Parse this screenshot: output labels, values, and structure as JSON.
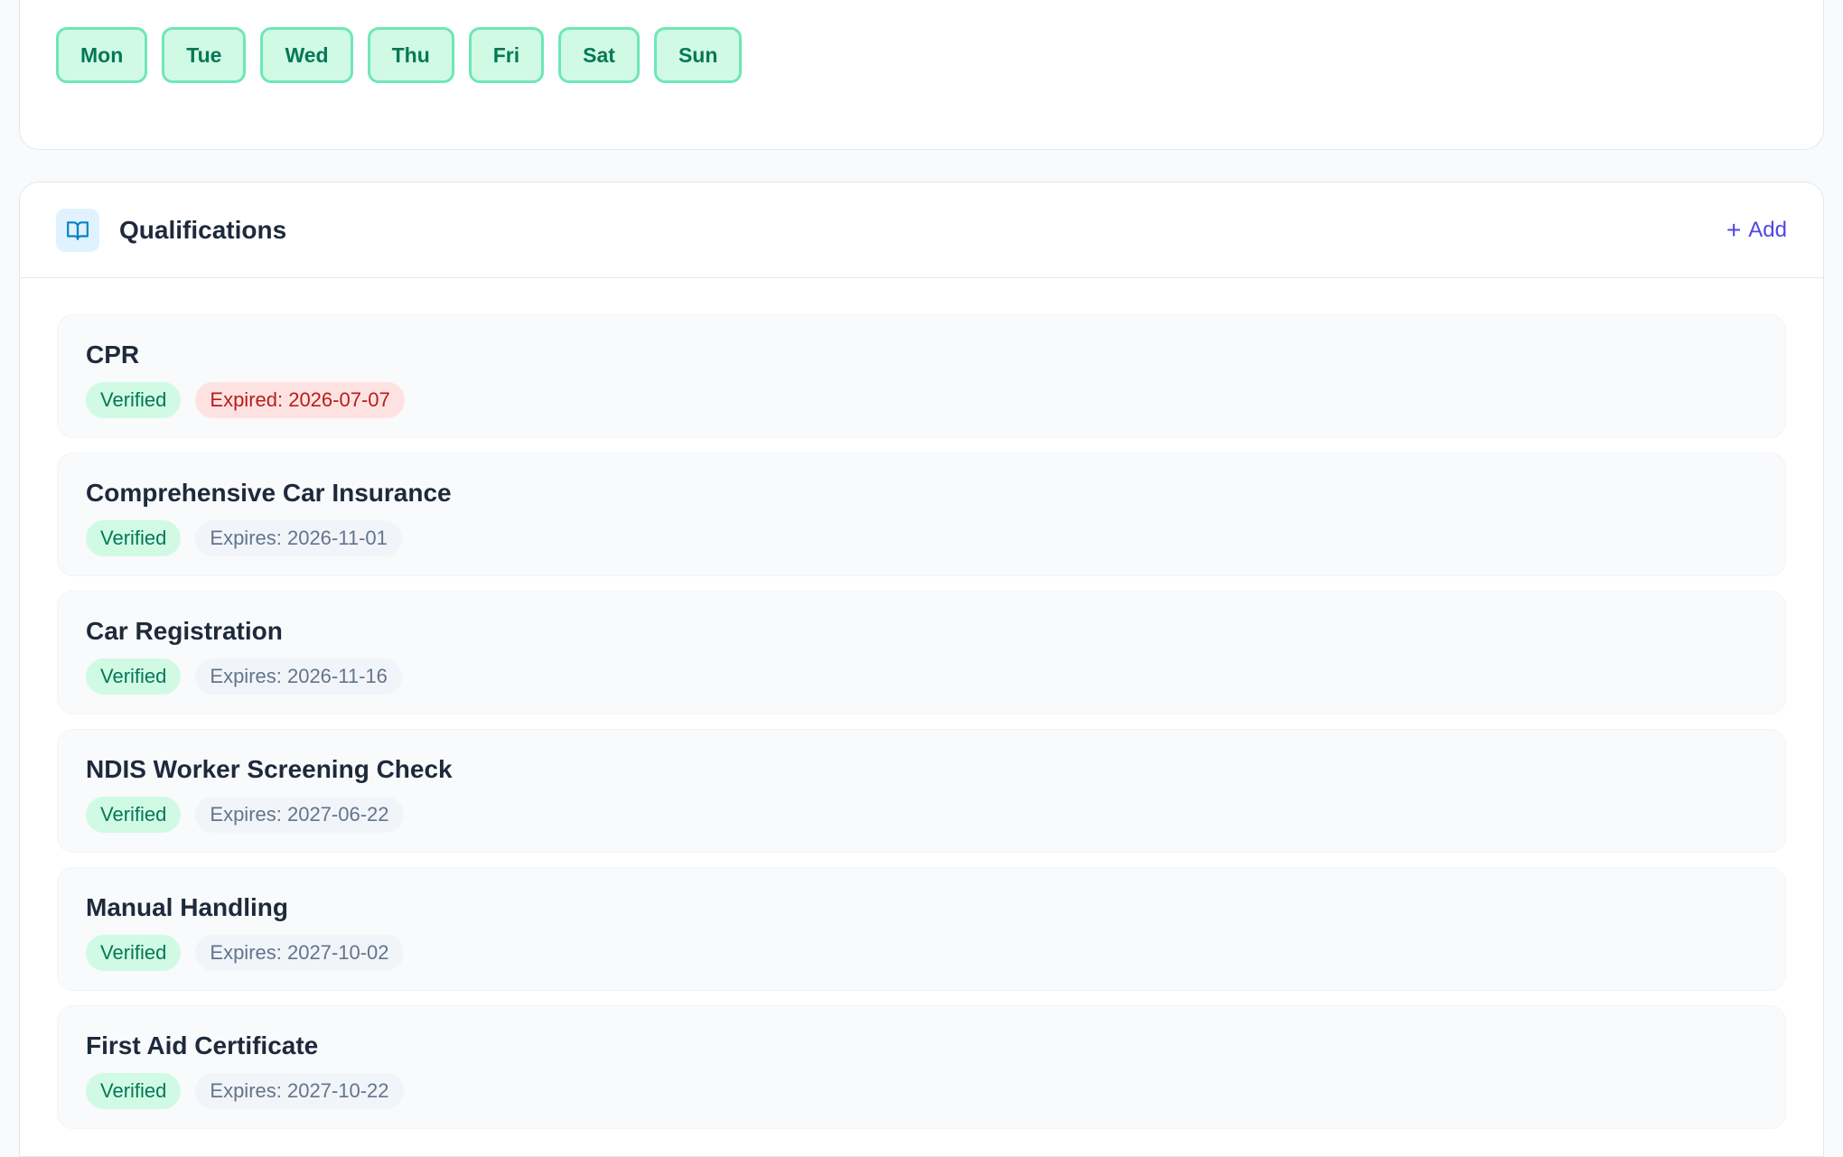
{
  "availability": {
    "days": [
      "Mon",
      "Tue",
      "Wed",
      "Thu",
      "Fri",
      "Sat",
      "Sun"
    ]
  },
  "qualifications": {
    "title": "Qualifications",
    "icon": "book-open-icon",
    "add_plus": "+",
    "add_label": "Add",
    "colors": {
      "accent": "#4f46e5",
      "verified_bg": "#d1fae5",
      "verified_text": "#047857",
      "expired_bg": "#fee2e2",
      "expired_text": "#b91c1c"
    },
    "items": [
      {
        "name": "CPR",
        "status": "Verified",
        "expiry": "Expired: 2026-07-07",
        "expired": true
      },
      {
        "name": "Comprehensive Car Insurance",
        "status": "Verified",
        "expiry": "Expires: 2026-11-01",
        "expired": false
      },
      {
        "name": "Car Registration",
        "status": "Verified",
        "expiry": "Expires: 2026-11-16",
        "expired": false
      },
      {
        "name": "NDIS Worker Screening Check",
        "status": "Verified",
        "expiry": "Expires: 2027-06-22",
        "expired": false
      },
      {
        "name": "Manual Handling",
        "status": "Verified",
        "expiry": "Expires: 2027-10-02",
        "expired": false
      },
      {
        "name": "First Aid Certificate",
        "status": "Verified",
        "expiry": "Expires: 2027-10-22",
        "expired": false
      }
    ]
  }
}
